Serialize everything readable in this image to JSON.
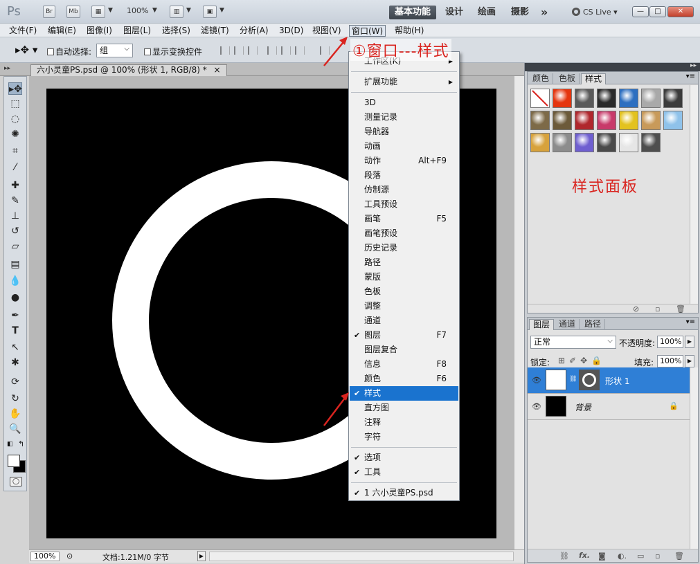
{
  "titlebar": {
    "logo": "Ps",
    "br_label": "Br",
    "mb_label": "Mb",
    "zoom": "100%",
    "workspaces": [
      "基本功能",
      "设计",
      "绘画",
      "摄影"
    ],
    "more": "»",
    "cslive": "CS Live ▾",
    "minimize": "—",
    "maximize": "□",
    "close": "✕"
  },
  "menubar": [
    "文件(F)",
    "编辑(E)",
    "图像(I)",
    "图层(L)",
    "选择(S)",
    "滤镜(T)",
    "分析(A)",
    "3D(D)",
    "视图(V)",
    "窗口(W)",
    "帮助(H)"
  ],
  "options": {
    "auto_select": "自动选择:",
    "auto_select_value": "组",
    "show_transform": "显示变换控件"
  },
  "document": {
    "tab": "六小灵童PS.psd @ 100% (形状 1, RGB/8) *",
    "tab_close": "×"
  },
  "status": {
    "zoom": "100%",
    "doc_info": "文档:1.21M/0 字节"
  },
  "window_menu": {
    "items": [
      {
        "label": "工作区(K)",
        "submenu": true
      },
      {
        "sep": true
      },
      {
        "label": "扩展功能",
        "submenu": true
      },
      {
        "sep": true
      },
      {
        "label": "3D"
      },
      {
        "label": "测量记录"
      },
      {
        "label": "导航器"
      },
      {
        "label": "动画"
      },
      {
        "label": "动作",
        "shortcut": "Alt+F9"
      },
      {
        "label": "段落"
      },
      {
        "label": "仿制源"
      },
      {
        "label": "工具预设"
      },
      {
        "label": "画笔",
        "shortcut": "F5"
      },
      {
        "label": "画笔预设"
      },
      {
        "label": "历史记录"
      },
      {
        "label": "路径"
      },
      {
        "label": "蒙版"
      },
      {
        "label": "色板"
      },
      {
        "label": "调整"
      },
      {
        "label": "通道"
      },
      {
        "label": "图层",
        "shortcut": "F7",
        "checked": true
      },
      {
        "label": "图层复合"
      },
      {
        "label": "信息",
        "shortcut": "F8"
      },
      {
        "label": "颜色",
        "shortcut": "F6"
      },
      {
        "label": "样式",
        "checked": true,
        "highlighted": true
      },
      {
        "label": "直方图"
      },
      {
        "label": "注释"
      },
      {
        "label": "字符"
      },
      {
        "sep": true
      },
      {
        "label": "选项",
        "checked": true
      },
      {
        "label": "工具",
        "checked": true
      },
      {
        "sep": true
      },
      {
        "label": "1 六小灵童PS.psd",
        "checked": true
      }
    ]
  },
  "annotation": {
    "callout": "①窗口---样式",
    "styles_panel_note": "样式面板"
  },
  "styles_panel": {
    "tabs": [
      "颜色",
      "色板",
      "样式"
    ],
    "active_tab": "样式",
    "swatches": [
      "#ffffff",
      "#e5350e",
      "#5a5a5a",
      "#2a2a2a",
      "#2d6fc0",
      "#a9a9a9",
      "#3b3b3b",
      "#7d6a48",
      "#6c5a3a",
      "#b0272d",
      "#c83a6a",
      "#e3c21e",
      "#c89a5a",
      "#8fc2ea",
      "#d7a23c",
      "#8c8c8c",
      "#6f5fd0",
      "#4a4a4a",
      "#e6e6e6",
      "#4e4e4e"
    ]
  },
  "layers_panel": {
    "tabs": [
      "图层",
      "通道",
      "路径"
    ],
    "active_tab": "图层",
    "blend_mode": "正常",
    "opacity_label": "不透明度:",
    "opacity": "100%",
    "lock_label": "锁定:",
    "fill_label": "填充:",
    "fill": "100%",
    "layers": [
      {
        "name": "形状 1",
        "selected": true
      },
      {
        "name": "背景",
        "selected": false,
        "locked": true
      }
    ],
    "bottom_icons": [
      "link-icon",
      "fx-icon",
      "mask-icon",
      "adjustment-icon",
      "group-icon",
      "new-layer-icon",
      "trash-icon"
    ]
  }
}
